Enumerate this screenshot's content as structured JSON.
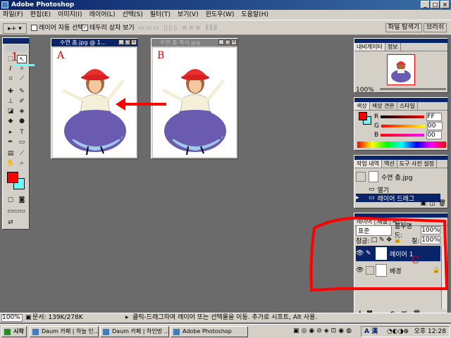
{
  "window": {
    "title": "Adobe Photoshop"
  },
  "menu": [
    "파일(F)",
    "편집(E)",
    "이미지(I)",
    "레이어(L)",
    "선택(S)",
    "필터(T)",
    "보기(V)",
    "윈도우(W)",
    "도움말(H)"
  ],
  "options": {
    "auto_select": "레이어 자동 선택",
    "bounding_box": "테두리 상자 보기",
    "palette_well_tabs": [
      "파일 탐색기",
      "브러쉬"
    ]
  },
  "documents": [
    {
      "title": "수연 춤.jpg @ 1...",
      "label": "A"
    },
    {
      "title": "수연 춤 복사.jpg",
      "label": "B"
    }
  ],
  "annotations": {
    "tool_number": "1",
    "layers_mark": "C"
  },
  "navigator": {
    "tabs": [
      "내비게이터",
      "정보"
    ],
    "zoom": "100%"
  },
  "color_panel": {
    "tabs": [
      "색상",
      "색상 견본",
      "스타일"
    ],
    "channels": [
      {
        "name": "R",
        "value": "FF"
      },
      {
        "name": "G",
        "value": "00"
      },
      {
        "name": "B",
        "value": "00"
      }
    ]
  },
  "history": {
    "tabs": [
      "작업 내역",
      "액션",
      "도구 사전 설정"
    ],
    "snapshot": "수연 춤.jpg",
    "items": [
      "열기",
      "레이어 드래그"
    ]
  },
  "layers": {
    "tabs": [
      "레이어",
      "채널",
      "패스"
    ],
    "blend_mode": "표준",
    "opacity_label": "불투명도:",
    "opacity": "100%",
    "lock_label": "잠금:",
    "fill_label": "칠:",
    "fill": "100%",
    "items": [
      {
        "name": "레이어 1",
        "selected": true
      },
      {
        "name": "배경",
        "selected": false
      }
    ]
  },
  "status": {
    "zoom": "100%",
    "doc_size": "문서: 139K/278K",
    "hint": "클릭-드래그하여 레이어 또는 선택물을 이동. 추가로 시프트, Alt 사용."
  },
  "taskbar": {
    "start": "시작",
    "buttons": [
      "Daum 카페 | 하늘 인...",
      "Daum 카페 | 하인방 ...",
      "",
      "Adobe Photoshop"
    ],
    "ime": "A 漢",
    "time": "오후 12:28"
  },
  "colors": {
    "foreground": "#ff0000",
    "background": "#66ffff",
    "annotation": "#ff0000"
  }
}
